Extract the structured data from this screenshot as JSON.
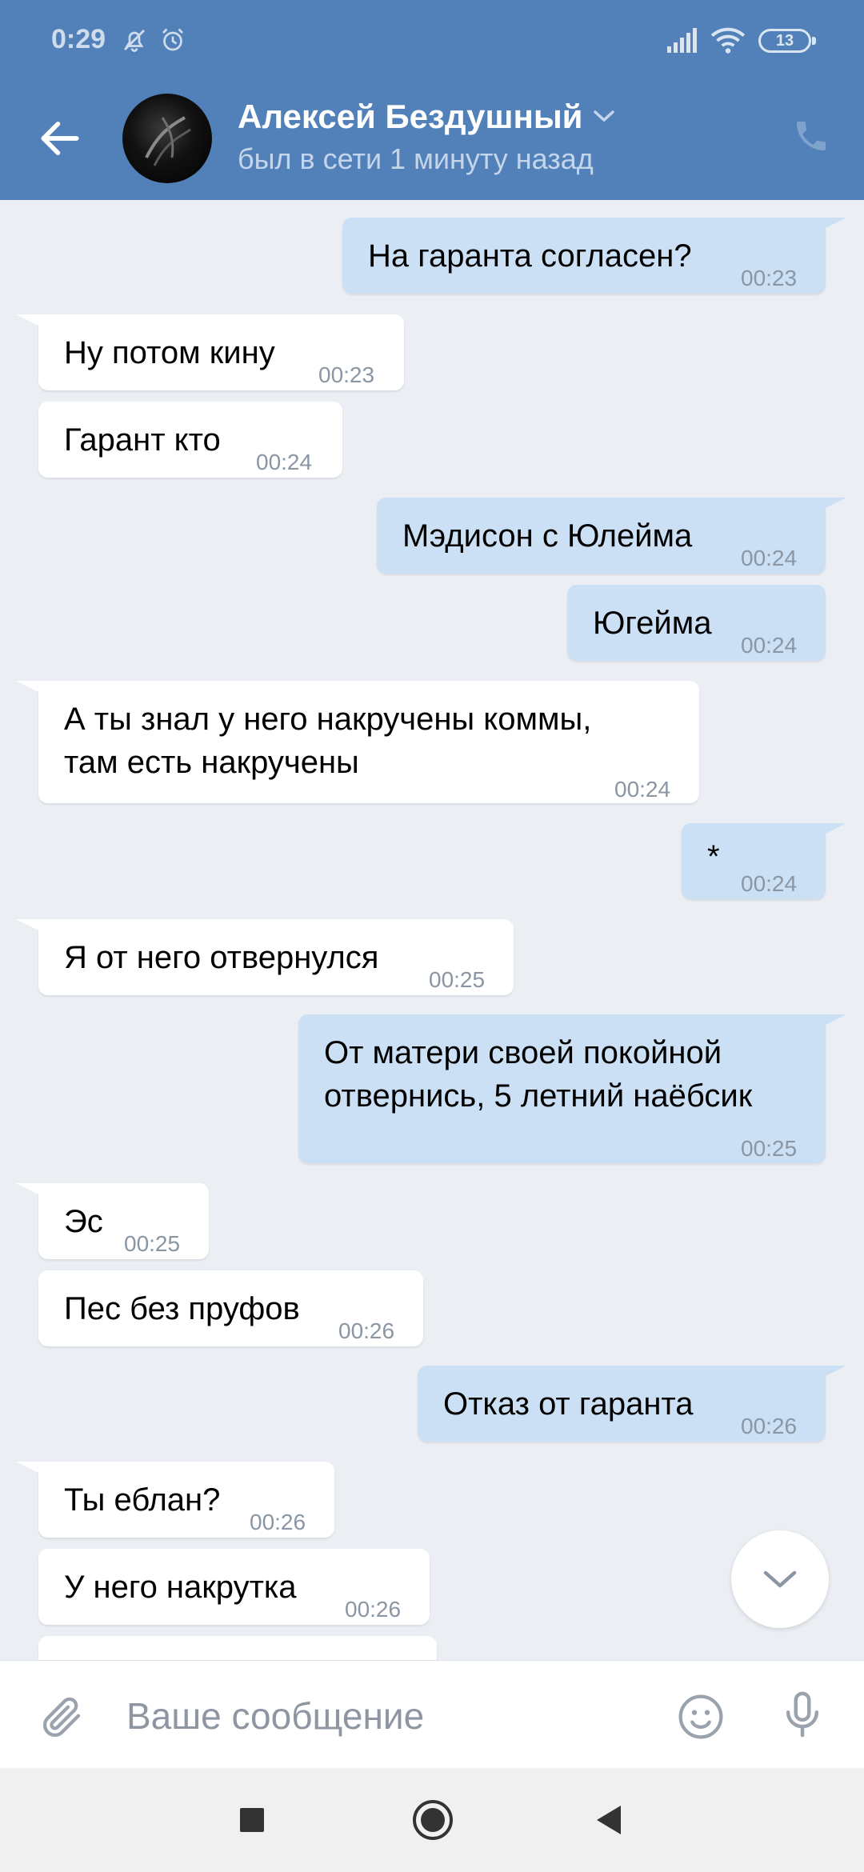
{
  "status_bar": {
    "time": "0:29",
    "battery": "13"
  },
  "header": {
    "name": "Алексей Бездушный",
    "status": "был в сети 1 минуту назад"
  },
  "messages": [
    {
      "dir": "out",
      "text": "На гаранта согласен?",
      "time": "00:23"
    },
    {
      "dir": "in",
      "text": "Ну потом кину",
      "time": "00:23"
    },
    {
      "dir": "in",
      "text": "Гарант кто",
      "time": "00:24"
    },
    {
      "dir": "out",
      "text": "Мэдисон с Юлейма",
      "time": "00:24"
    },
    {
      "dir": "out",
      "text": "Югейма",
      "time": "00:24"
    },
    {
      "dir": "in",
      "text": "А ты знал у него накручены коммы,",
      "text2": "там есть накручены",
      "time": "00:24"
    },
    {
      "dir": "out",
      "text": "*",
      "time": "00:24"
    },
    {
      "dir": "in",
      "text": "Я от него отвернулся",
      "time": "00:25"
    },
    {
      "dir": "out",
      "text": "От матери своей покойной",
      "text2": "отвернись, 5 летний наёбсик",
      "time": "00:25"
    },
    {
      "dir": "in",
      "text": "Эс",
      "time": "00:25"
    },
    {
      "dir": "in",
      "text": "Пес без пруфов",
      "time": "00:26"
    },
    {
      "dir": "out",
      "text": "Отказ от гаранта",
      "time": "00:26"
    },
    {
      "dir": "in",
      "text": "Ты еблан?",
      "time": "00:26"
    },
    {
      "dir": "in",
      "text": "У него накрутка",
      "time": "00:26"
    }
  ],
  "composer": {
    "placeholder": "Ваше сообщение"
  },
  "icons": {
    "back": "arrow-left-icon",
    "call": "phone-icon",
    "attach": "paperclip-icon",
    "emoji": "smile-icon",
    "mic": "microphone-icon",
    "scroll": "chevron-down-icon"
  },
  "colors": {
    "header": "#5181b8",
    "background": "#ebeff4",
    "outgoing_bubble": "#cce0f5",
    "incoming_bubble": "#ffffff"
  }
}
